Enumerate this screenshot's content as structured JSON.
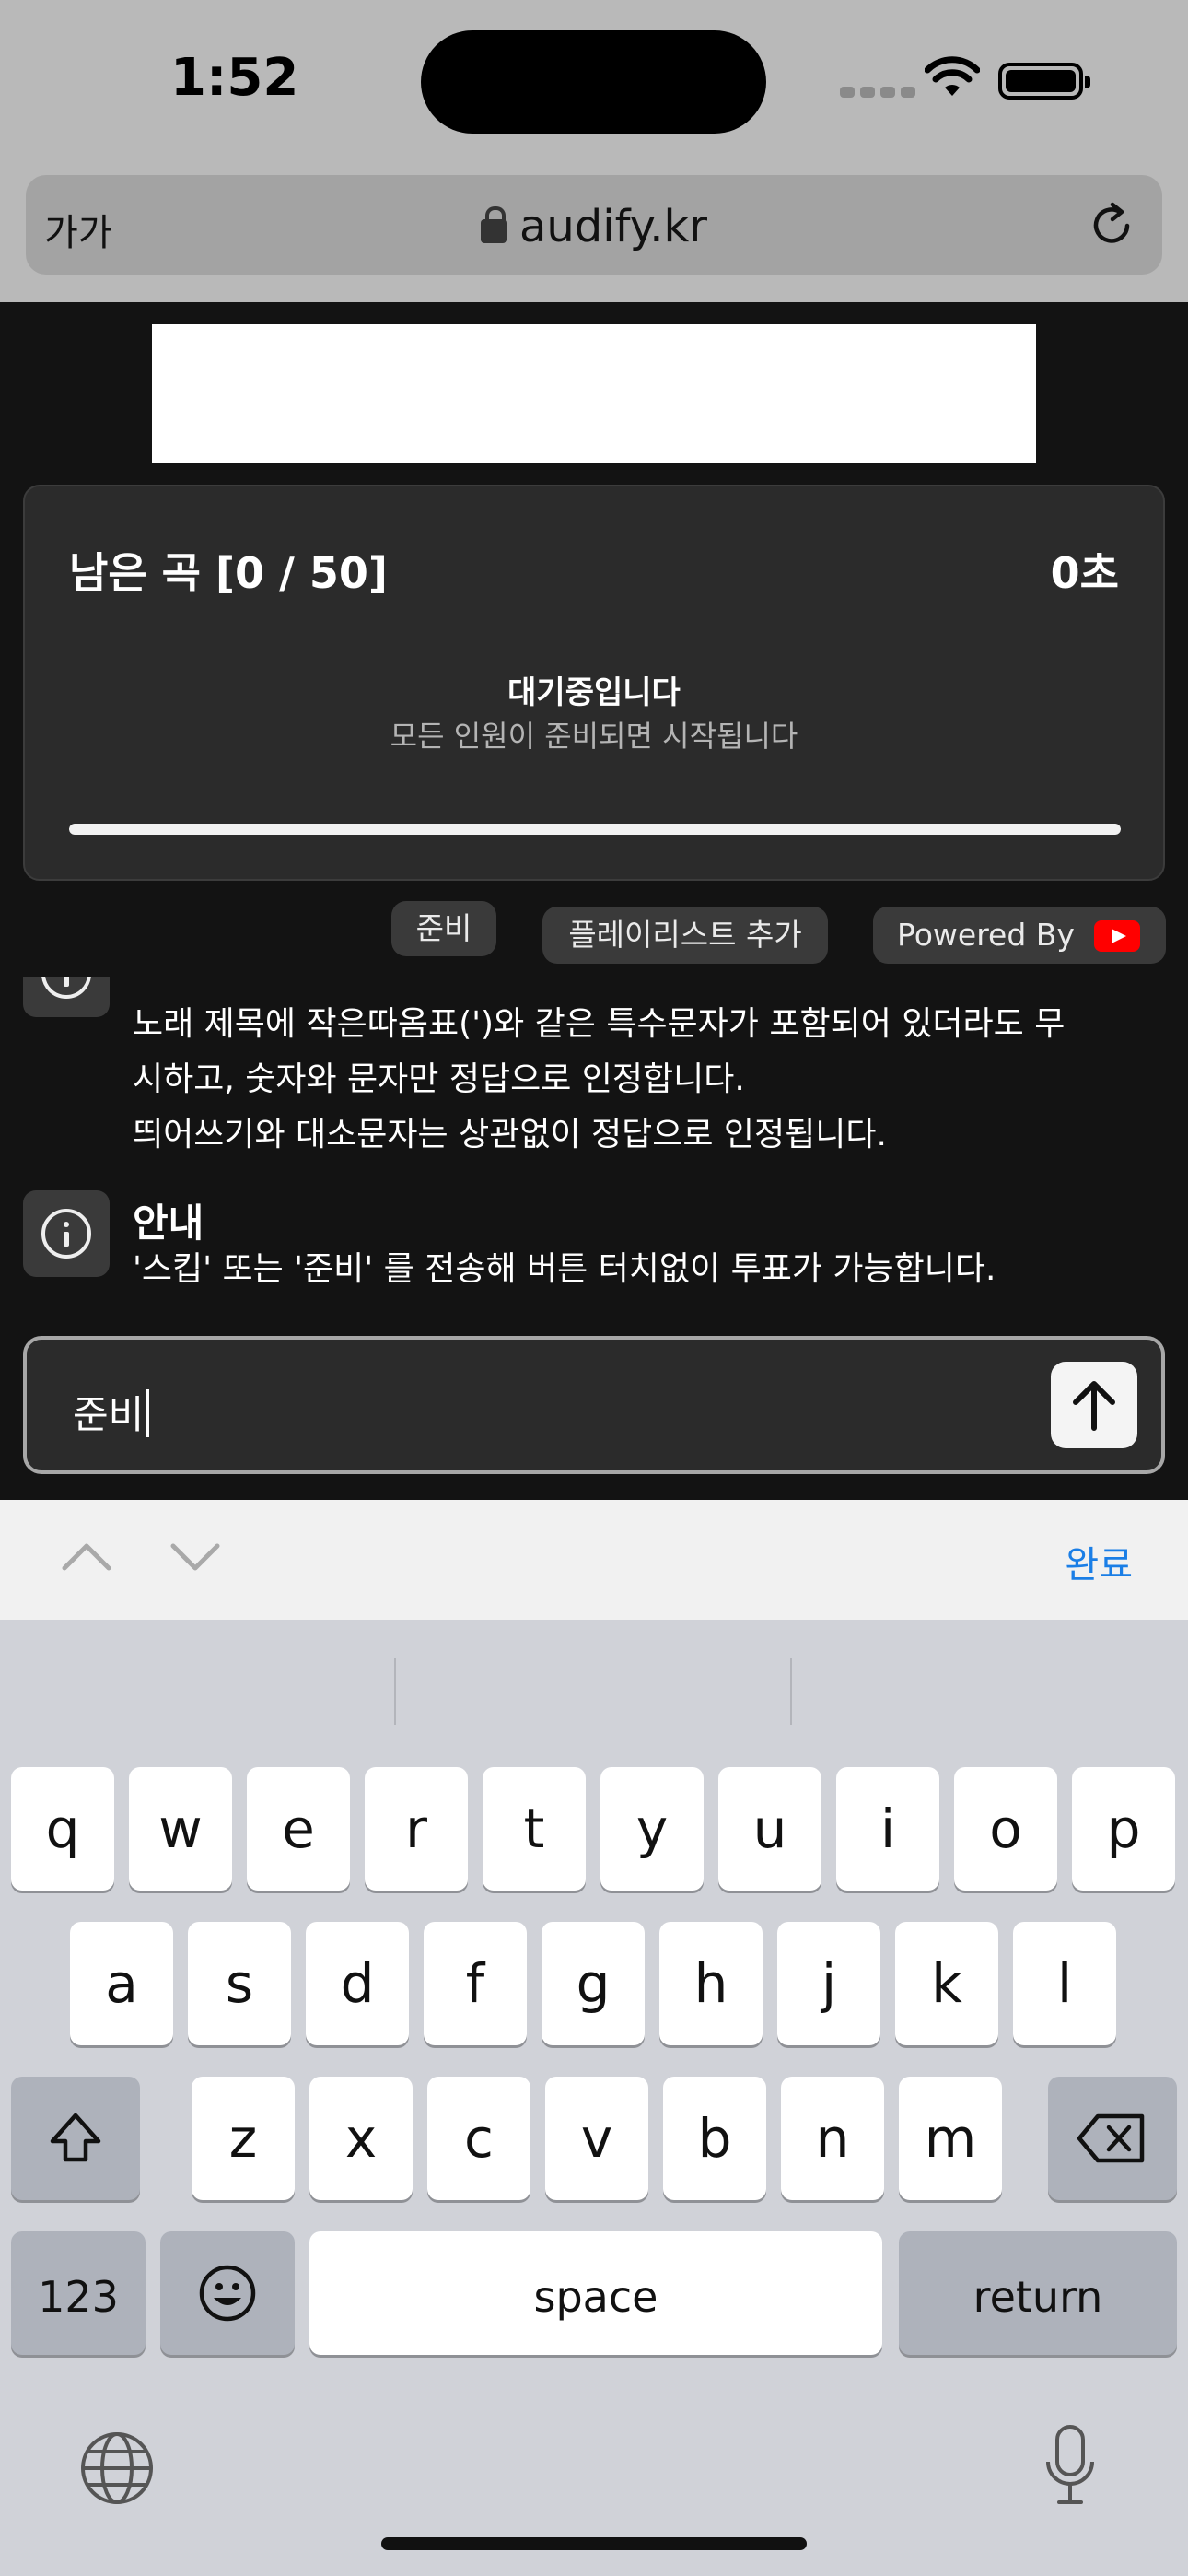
{
  "status_bar": {
    "time": "1:52"
  },
  "browser": {
    "text_size_button": "가가",
    "url": "audify.kr"
  },
  "game": {
    "remaining_label": "남은 곡 [0 / 50]",
    "timer": "0초",
    "waiting_title": "대기중입니다",
    "waiting_subtitle": "모든 인원이 준비되면 시작됩니다",
    "progress_percent": 100
  },
  "actions": {
    "ready": "준비",
    "add_playlist": "플레이리스트 추가",
    "powered_by": "Powered By"
  },
  "notices": [
    {
      "lines": [
        "노래 제목에 작은따옴표(')와 같은 특수문자가 포함되어 있더라도 무",
        "시하고, 숫자와 문자만 정답으로 인정합니다.",
        "띄어쓰기와 대소문자는 상관없이 정답으로 인정됩니다."
      ]
    },
    {
      "title": "안내",
      "lines": [
        "'스킵' 또는 '준비' 를 전송해 버튼 터치없이 투표가 가능합니다."
      ]
    }
  ],
  "chat": {
    "value": "준비"
  },
  "keyboard_toolbar": {
    "done": "완료"
  },
  "keyboard": {
    "row1": [
      "q",
      "w",
      "e",
      "r",
      "t",
      "y",
      "u",
      "i",
      "o",
      "p"
    ],
    "row2": [
      "a",
      "s",
      "d",
      "f",
      "g",
      "h",
      "j",
      "k",
      "l"
    ],
    "row3": [
      "z",
      "x",
      "c",
      "v",
      "b",
      "n",
      "m"
    ],
    "numbers_key": "123",
    "space_key": "space",
    "return_key": "return"
  }
}
